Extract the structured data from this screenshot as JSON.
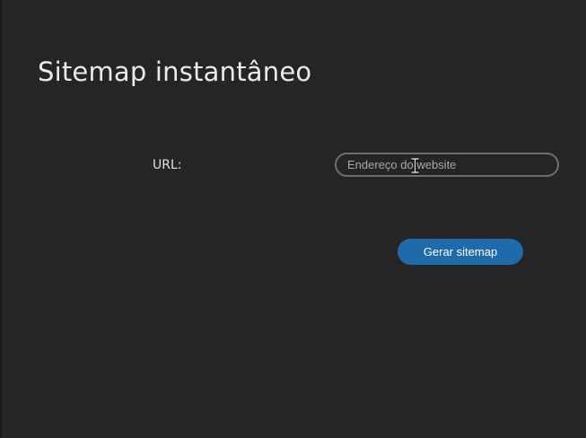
{
  "page": {
    "title": "Sitemap instantâneo"
  },
  "form": {
    "url_label": "URL:",
    "url_placeholder": "Endereço do website",
    "url_value": "",
    "submit_label": "Gerar sitemap"
  },
  "icons": {
    "text_cursor": "text-cursor-icon"
  },
  "colors": {
    "background": "#252525",
    "accent": "#1f6aab",
    "input_border": "#6e6e6e",
    "text": "#eaeaea"
  }
}
